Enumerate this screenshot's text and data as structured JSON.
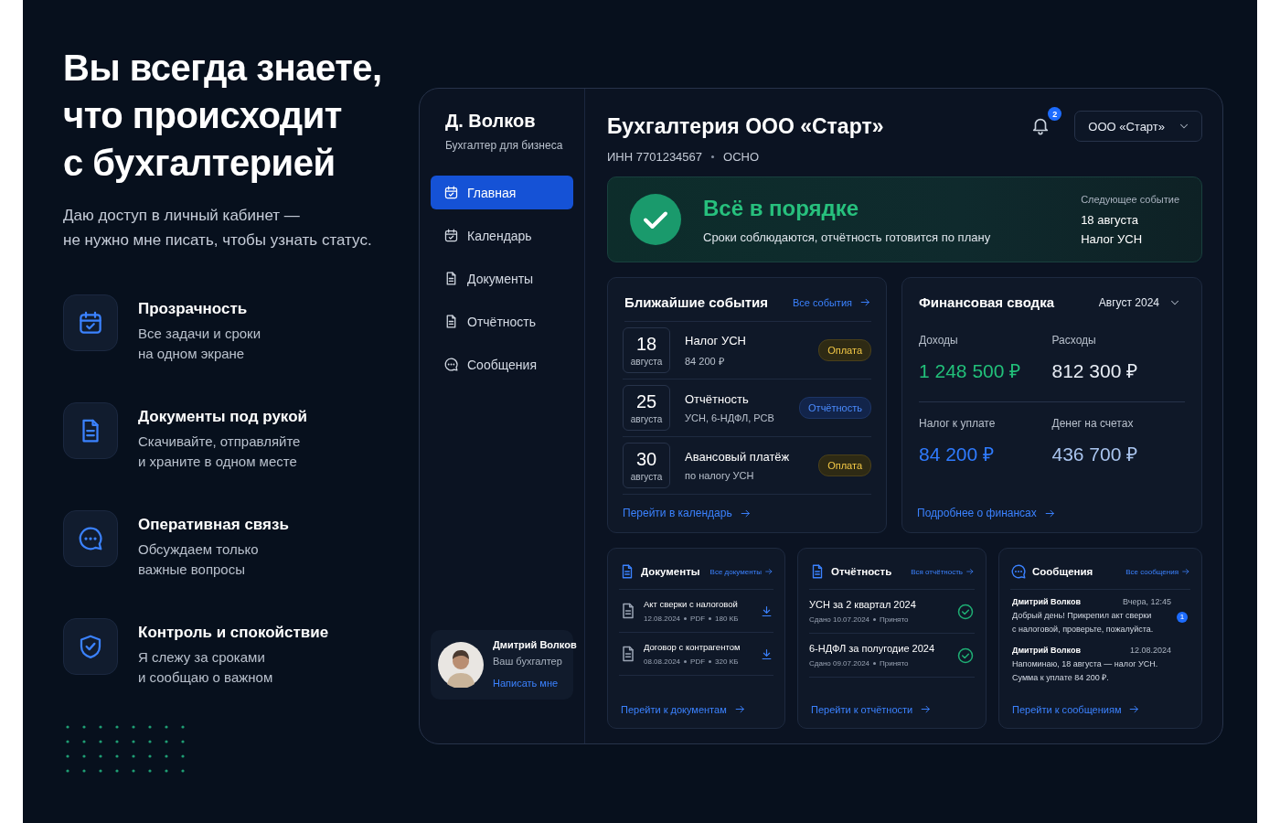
{
  "hero": {
    "title": "Вы всегда знаете,\nчто происходит\nс бухгалтерией",
    "subtitle": "Даю доступ в личный кабинет —\nне нужно мне писать, чтобы узнать статус."
  },
  "features": [
    {
      "kind": "calendar",
      "title": "Прозрачность",
      "text": "Все задачи и сроки\nна одном экране"
    },
    {
      "kind": "document",
      "title": "Документы под рукой",
      "text": "Скачивайте, отправляйте\nи храните в одном месте"
    },
    {
      "kind": "chat",
      "title": "Оперативная связь",
      "text": "Обсуждаем только\nважные вопросы"
    },
    {
      "kind": "shield",
      "title": "Контроль и спокойствие",
      "text": "Я слежу за сроками\nи сообщаю о важном"
    }
  ],
  "sidebar": {
    "name": "Д. Волков",
    "role": "Бухгалтер для бизнеса",
    "nav": [
      {
        "kind": "calendar",
        "label": "Главная",
        "selected": true
      },
      {
        "kind": "calendar",
        "label": "Календарь",
        "selected": false
      },
      {
        "kind": "document",
        "label": "Документы",
        "selected": false
      },
      {
        "kind": "document",
        "label": "Отчётность",
        "selected": false
      },
      {
        "kind": "chat",
        "label": "Сообщения",
        "selected": false
      }
    ],
    "contact": {
      "name": "Дмитрий Волков",
      "role": "Ваш бухгалтер",
      "link": "Написать мне"
    }
  },
  "header": {
    "title": "Бухгалтерия ООО «Старт»",
    "inn": "ИНН 7701234567",
    "tax_system": "ОСНО",
    "notifications": "2",
    "company": "ООО «Старт»"
  },
  "status": {
    "title": "Всё в порядке",
    "text": "Сроки соблюдаются, отчётность готовится по плану",
    "next_label": "Следующее событие",
    "next_date": "18 августа",
    "next_name": "Налог УСН"
  },
  "events": {
    "title": "Ближайшие события",
    "link": "Все события",
    "footer_link": "Перейти в календарь",
    "items": [
      {
        "day": "18",
        "month": "августа",
        "title": "Налог УСН",
        "subtitle": "84 200 ₽",
        "tag": "Оплата",
        "kind": "payment"
      },
      {
        "day": "25",
        "month": "августа",
        "title": "Отчётность",
        "subtitle": "УСН, 6-НДФЛ, РСВ",
        "tag": "Отчётность",
        "kind": "report"
      },
      {
        "day": "30",
        "month": "августа",
        "title": "Авансовый платёж",
        "subtitle": "по налогу УСН",
        "tag": "Оплата",
        "kind": "payment"
      }
    ]
  },
  "finance": {
    "title": "Финансовая сводка",
    "period": "Август 2024",
    "footer_link": "Подробнее о финансах",
    "metrics": [
      {
        "label": "Доходы",
        "value": "1 248 500 ₽",
        "color": "#22c07a"
      },
      {
        "label": "Расходы",
        "value": "812 300 ₽",
        "color": "#e8edf5"
      },
      {
        "label": "Налог к уплате",
        "value": "84 200 ₽",
        "color": "#2f7bff"
      },
      {
        "label": "Денег на счетах",
        "value": "436 700 ₽",
        "color": "#a9c4ee"
      }
    ]
  },
  "documents": {
    "title": "Документы",
    "link": "Все документы",
    "footer_link": "Перейти к документам",
    "items": [
      {
        "name": "Акт сверки с налоговой",
        "date": "12.08.2024",
        "format": "PDF",
        "size": "180 КБ"
      },
      {
        "name": "Договор с контрагентом",
        "date": "08.08.2024",
        "format": "PDF",
        "size": "320 КБ"
      }
    ]
  },
  "reports": {
    "title": "Отчётность",
    "link": "Вся отчётность",
    "footer_link": "Перейти к отчётности",
    "items": [
      {
        "name": "УСН за 2 квартал 2024",
        "date": "Сдано 10.07.2024",
        "status": "Принято",
        "accepted": true
      },
      {
        "name": "6-НДФЛ за полугодие 2024",
        "date": "Сдано 09.07.2024",
        "status": "Принято",
        "accepted": true
      }
    ]
  },
  "messages": {
    "title": "Сообщения",
    "link": "Все сообщения",
    "footer_link": "Перейти к сообщениям",
    "items": [
      {
        "author": "Дмитрий Волков",
        "time": "Вчера, 12:45",
        "text": "Добрый день! Прикрепил акт сверки\nс налоговой, проверьте, пожалуйста.",
        "badge": "1"
      },
      {
        "author": "Дмитрий Волков",
        "time": "12.08.2024",
        "text": "Напоминаю, 18 августа — налог УСН.\nСумма к уплате 84 200 ₽."
      }
    ]
  }
}
